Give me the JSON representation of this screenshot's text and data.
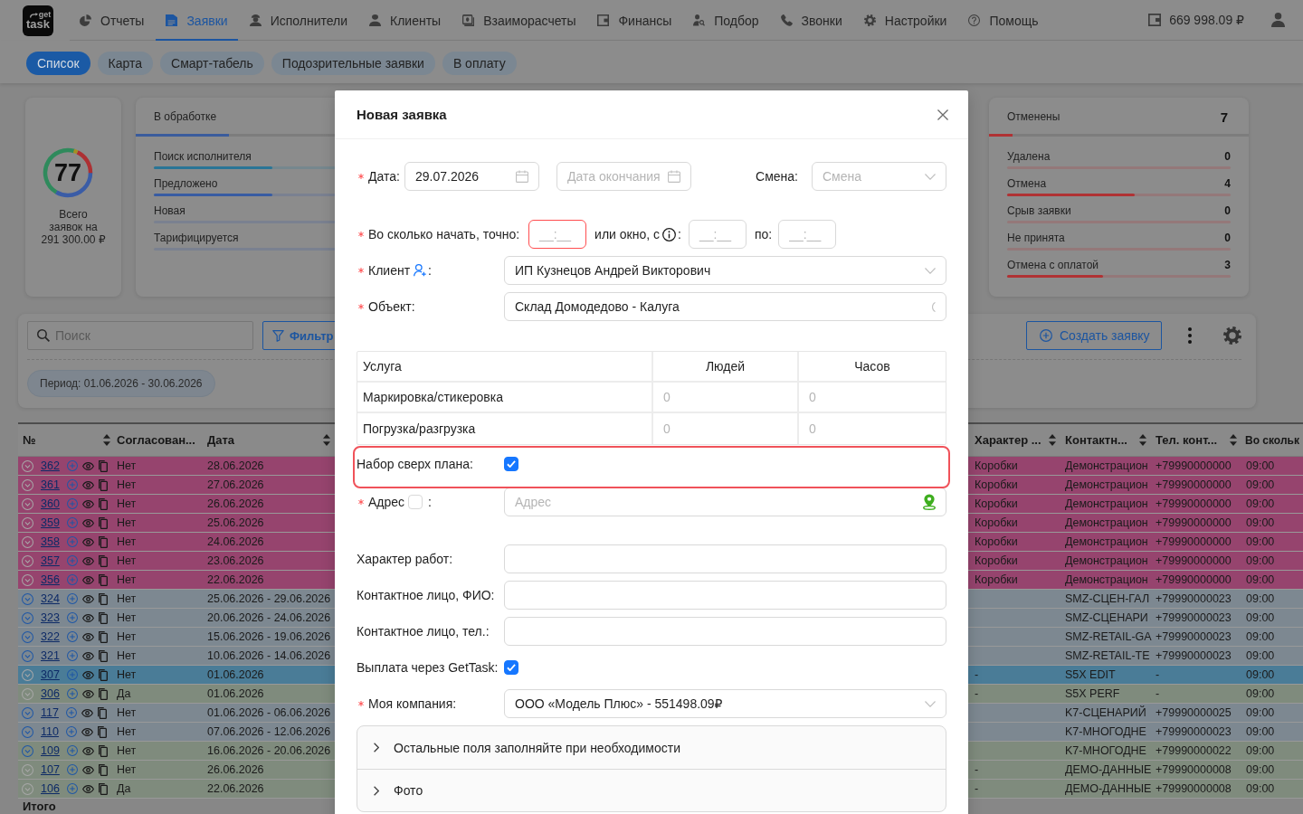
{
  "header": {
    "logo": {
      "top": "get",
      "bottom": "task"
    },
    "nav": [
      {
        "kind": "reports",
        "label": "Отчеты",
        "selected": false
      },
      {
        "kind": "orders",
        "label": "Заявки",
        "selected": true
      },
      {
        "kind": "workers",
        "label": "Исполнители",
        "selected": false
      },
      {
        "kind": "clients",
        "label": "Клиенты",
        "selected": false
      },
      {
        "kind": "settlements",
        "label": "Взаиморасчеты",
        "selected": false
      },
      {
        "kind": "finance",
        "label": "Финансы",
        "selected": false
      },
      {
        "kind": "recruiting",
        "label": "Подбор",
        "selected": false
      },
      {
        "kind": "calls",
        "label": "Звонки",
        "selected": false
      },
      {
        "kind": "settings",
        "label": "Настройки",
        "selected": false
      },
      {
        "kind": "help",
        "label": "Помощь",
        "selected": false
      }
    ],
    "balance": "669 998.09 ₽"
  },
  "subtabs": [
    {
      "label": "Список",
      "selected": true
    },
    {
      "label": "Карта",
      "selected": false
    },
    {
      "label": "Смарт-табель",
      "selected": false
    },
    {
      "label": "Подозрительные заявки",
      "selected": false
    },
    {
      "label": "В оплату",
      "selected": false
    }
  ],
  "stats": {
    "total": {
      "count": "77",
      "caption": "Всего заявок на 291 300.00 ₽"
    },
    "groups": [
      {
        "title": "В обработке",
        "level": 0.36,
        "color": "#3a5c9c",
        "items": [
          {
            "label": "Поиск исполнителя",
            "level": 0.53,
            "color": "#2a7596"
          },
          {
            "label": "Предложено",
            "level": 0.53,
            "color": "#385ca3"
          },
          {
            "label": "Новая",
            "level": 0
          },
          {
            "label": "Тарифицируется",
            "level": 0
          }
        ]
      },
      {
        "title": "Отменены",
        "count": "7",
        "level": 0.09,
        "color": "#b03234",
        "items": [
          {
            "label": "Удалена",
            "count": "0",
            "level": 0
          },
          {
            "label": "Отмена",
            "count": "4",
            "level": 0.57
          },
          {
            "label": "Срыв заявки",
            "count": "0",
            "level": 0
          },
          {
            "label": "Не принята",
            "count": "0",
            "level": 0
          },
          {
            "label": "Отмена с оплатой",
            "count": "3",
            "level": 0.43
          }
        ]
      }
    ]
  },
  "toolbar": {
    "search": {
      "placeholder": "Поиск"
    },
    "filter": "Фильтр",
    "period": "Период: 01.06.2026 - 30.06.2026",
    "create": "Создать заявку"
  },
  "table": {
    "columns": [
      {
        "label": "№",
        "sortable": true
      },
      {
        "label": "Согласован...",
        "sortable": false
      },
      {
        "label": "Дата",
        "sortable": true
      },
      {
        "label": "Характер ...",
        "sortable": true
      },
      {
        "label": "Контактн...",
        "sortable": true
      },
      {
        "label": "Тел. конт...",
        "sortable": true
      },
      {
        "label": "Во скольк"
      }
    ],
    "rows": [
      {
        "number": "362",
        "column_2": "Нет",
        "date": "28.06.2026",
        "column_4": "Коробки",
        "column_5": "Демонстрацион",
        "column_6": "+79990000000",
        "column_7": "09:00",
        "color": "#96446e",
        "expandable": false
      },
      {
        "number": "361",
        "column_2": "Нет",
        "date": "27.06.2026",
        "column_4": "Коробки",
        "column_5": "Демонстрацион",
        "column_6": "+79990000000",
        "column_7": "09:00",
        "color": "#96446e",
        "expandable": false
      },
      {
        "number": "360",
        "column_2": "Нет",
        "date": "26.06.2026",
        "column_4": "Коробки",
        "column_5": "Демонстрацион",
        "column_6": "+79990000000",
        "column_7": "09:00",
        "color": "#96446e",
        "expandable": false
      },
      {
        "number": "359",
        "column_2": "Нет",
        "date": "25.06.2026",
        "column_4": "Коробки",
        "column_5": "Демонстрацион",
        "column_6": "+79990000000",
        "column_7": "09:00",
        "color": "#96446e",
        "expandable": false
      },
      {
        "number": "358",
        "column_2": "Нет",
        "date": "24.06.2026",
        "column_4": "Коробки",
        "column_5": "Демонстрацион",
        "column_6": "+79990000000",
        "column_7": "09:00",
        "color": "#96446e",
        "expandable": false
      },
      {
        "number": "357",
        "column_2": "Нет",
        "date": "23.06.2026",
        "column_4": "Коробки",
        "column_5": "Демонстрацион",
        "column_6": "+79990000000",
        "column_7": "09:00",
        "color": "#96446e",
        "expandable": false
      },
      {
        "number": "356",
        "column_2": "Нет",
        "date": "22.06.2026",
        "column_4": "Коробки",
        "column_5": "Демонстрацион",
        "column_6": "+79990000000",
        "column_7": "09:00",
        "color": "#96446e",
        "expandable": false
      },
      {
        "number": "324",
        "column_2": "Нет",
        "date": "25.06.2026 - 29.06.2026",
        "column_5": "SMZ-СЦЕН-ГАЛ",
        "column_6": "+79990000023",
        "column_7": "09:00",
        "color": "#7d8891",
        "expandable": true
      },
      {
        "number": "323",
        "column_2": "Нет",
        "date": "20.06.2026 - 24.06.2026",
        "column_5": "SMZ-СЦЕНАРИ",
        "column_6": "+79990000023",
        "column_7": "09:00",
        "color": "#7d8891",
        "expandable": true
      },
      {
        "number": "322",
        "column_2": "Нет",
        "date": "15.06.2026 - 19.06.2026",
        "column_5": "SMZ-RETAIL-GA",
        "column_6": "+79990000023",
        "column_7": "09:00",
        "color": "#7d8891",
        "expandable": true
      },
      {
        "number": "321",
        "column_2": "Нет",
        "date": "10.06.2026 - 14.06.2026",
        "column_5": "SMZ-RETAIL-TE",
        "column_6": "+79990000023",
        "column_7": "09:00",
        "color": "#7d8891",
        "expandable": true
      },
      {
        "number": "307",
        "column_2": "Нет",
        "date": "01.06.2026",
        "column_4": "-",
        "column_5": "S5X EDIT",
        "column_6": "-",
        "column_7": "09:00",
        "color": "#4a7c97",
        "expandable": false
      },
      {
        "number": "306",
        "column_2": "Да",
        "date": "01.06.2026",
        "column_4": "-",
        "column_5": "S5X PERF",
        "column_6": "-",
        "column_7": "09:00",
        "color": "#7f8b7d",
        "expandable": false
      },
      {
        "number": "117",
        "column_2": "Нет",
        "date": "01.06.2026 - 06.06.2026",
        "column_5": "K7-СЦЕНАРИЙ",
        "column_6": "+79990000025",
        "column_7": "09:00",
        "color": "#7d8891",
        "expandable": true
      },
      {
        "number": "110",
        "column_2": "Нет",
        "date": "07.06.2026 - 12.06.2026",
        "column_5": "K7-МНОГОДНЕ",
        "column_6": "+79990000023",
        "column_7": "09:00",
        "color": "#7d8891",
        "expandable": true
      },
      {
        "number": "109",
        "column_2": "Нет",
        "date": "16.06.2026 - 20.06.2026",
        "column_5": "K7-МНОГОДНЕ",
        "column_6": "+79990000022",
        "column_7": "09:00",
        "color": "#7f8b7d",
        "expandable": true
      },
      {
        "number": "107",
        "column_2": "Нет",
        "date": "26.06.2026",
        "column_4": "-",
        "column_5": "ДЕМО-ДАННЫЕ",
        "column_6": "+79990000008",
        "column_7": "09:00",
        "color": "#7f8b7d",
        "expandable": false
      },
      {
        "number": "106",
        "column_2": "Да",
        "date": "22.06.2026",
        "column_4": "-",
        "column_5": "ДЕМО-ДАННЫЕ",
        "column_6": "+79990000008",
        "column_7": "09:00",
        "color": "#7f8b7d",
        "expandable": false
      }
    ],
    "footer": "Итого"
  },
  "modal": {
    "title": "Новая заявка",
    "date_row": {
      "label": "Дата:",
      "required": true,
      "start": {
        "value": "29.07.2026"
      },
      "end": {
        "placeholder": "Дата окончания"
      },
      "shift_label": "Смена:",
      "shift": {
        "placeholder": "Смена"
      }
    },
    "time_row": {
      "label": "Во сколько начать, точно:",
      "required": true,
      "exact": {
        "placeholder": "__:__",
        "error": true
      },
      "window_label": "или окно, с",
      "window_colon": ":",
      "from": {
        "placeholder": "__:__",
        "error": false
      },
      "to_label": "по:",
      "to": {
        "placeholder": "__:__",
        "error": false
      }
    },
    "party": [
      {
        "kind": "client",
        "label": "Клиент",
        "colon": ":",
        "required": true,
        "value": "ИП Кузнецов Андрей Викторович",
        "loading": false,
        "highlighted": false
      },
      {
        "kind": "select",
        "label": "Объект:",
        "required": true,
        "value": "Склад Домодедово - Калуга",
        "loading": true,
        "highlighted": false
      }
    ],
    "services": {
      "columns": [
        "Услуга",
        "Людей",
        "Часов"
      ],
      "rows": [
        {
          "name": "Маркировка/стикеровка",
          "people": {
            "placeholder": "0"
          },
          "hours": {
            "placeholder": "0"
          }
        },
        {
          "name": "Погрузка/разгрузка",
          "people": {
            "placeholder": "0"
          },
          "hours": {
            "placeholder": "0"
          }
        }
      ]
    },
    "extras": [
      {
        "kind": "checkbox",
        "label": "Набор сверх плана:",
        "required": false,
        "checked": true,
        "highlighted": true
      },
      {
        "kind": "address",
        "label": "Адрес",
        "colon": ":",
        "required": true,
        "label_checked": false,
        "placeholder": "Адрес",
        "highlighted": false
      }
    ],
    "details": [
      {
        "kind": "input",
        "label": "Характер работ:",
        "required": false,
        "highlighted": false
      },
      {
        "kind": "input",
        "label": "Контактное лицо, ФИО:",
        "required": false,
        "highlighted": false
      },
      {
        "kind": "input",
        "label": "Контактное лицо, тел.:",
        "required": false,
        "highlighted": false
      },
      {
        "kind": "checkbox",
        "label": "Выплата через GetTask:",
        "required": false,
        "checked": true,
        "highlighted": false
      },
      {
        "kind": "select",
        "label": "Моя компания:",
        "required": true,
        "value": "ООО «Модель Плюс» - 551498.09₽",
        "loading": false,
        "highlighted": false
      }
    ],
    "panels": [
      {
        "label": "Остальные поля заполняйте при необходимости",
        "expanded": false
      },
      {
        "label": "Фото",
        "expanded": false
      }
    ]
  }
}
